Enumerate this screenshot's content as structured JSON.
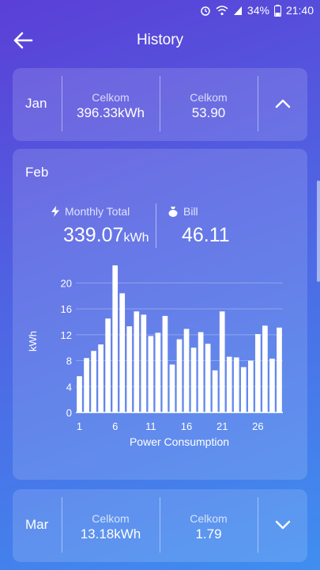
{
  "status": {
    "battery": "34%",
    "time": "21:40"
  },
  "header": {
    "title": "History"
  },
  "months": {
    "jan": {
      "name": "Jan",
      "stat1_label": "Celkom",
      "stat1_value": "396.33kWh",
      "stat2_label": "Celkom",
      "stat2_value": "53.90"
    },
    "feb": {
      "name": "Feb",
      "total_label": "Monthly Total",
      "total_value": "339.07",
      "total_unit": "kWh",
      "bill_label": "Bill",
      "bill_value": "46.11"
    },
    "mar": {
      "name": "Mar",
      "stat1_label": "Celkom",
      "stat1_value": "13.18kWh",
      "stat2_label": "Celkom",
      "stat2_value": "1.79"
    }
  },
  "chart_data": {
    "type": "bar",
    "xlabel": "Power Consumption",
    "ylabel": "kWh",
    "ylim": [
      0,
      22
    ],
    "yticks": [
      0,
      4,
      8,
      12,
      16,
      20
    ],
    "xticks": [
      1,
      6,
      11,
      16,
      21,
      26
    ],
    "categories": [
      1,
      2,
      3,
      4,
      5,
      6,
      7,
      8,
      9,
      10,
      11,
      12,
      13,
      14,
      15,
      16,
      17,
      18,
      19,
      20,
      21,
      22,
      23,
      24,
      25,
      26,
      27,
      28,
      29
    ],
    "values": [
      5.6,
      8.4,
      9.5,
      10.5,
      14.5,
      22.7,
      18.4,
      13.3,
      15.6,
      15.1,
      11.8,
      12.3,
      14.9,
      7.4,
      11.3,
      12.9,
      10.0,
      12.4,
      10.6,
      6.5,
      15.6,
      8.6,
      8.5,
      7.0,
      8.0,
      12.1,
      13.4,
      8.3,
      13.1
    ],
    "grid": true,
    "bar_color": "#ffffff"
  }
}
